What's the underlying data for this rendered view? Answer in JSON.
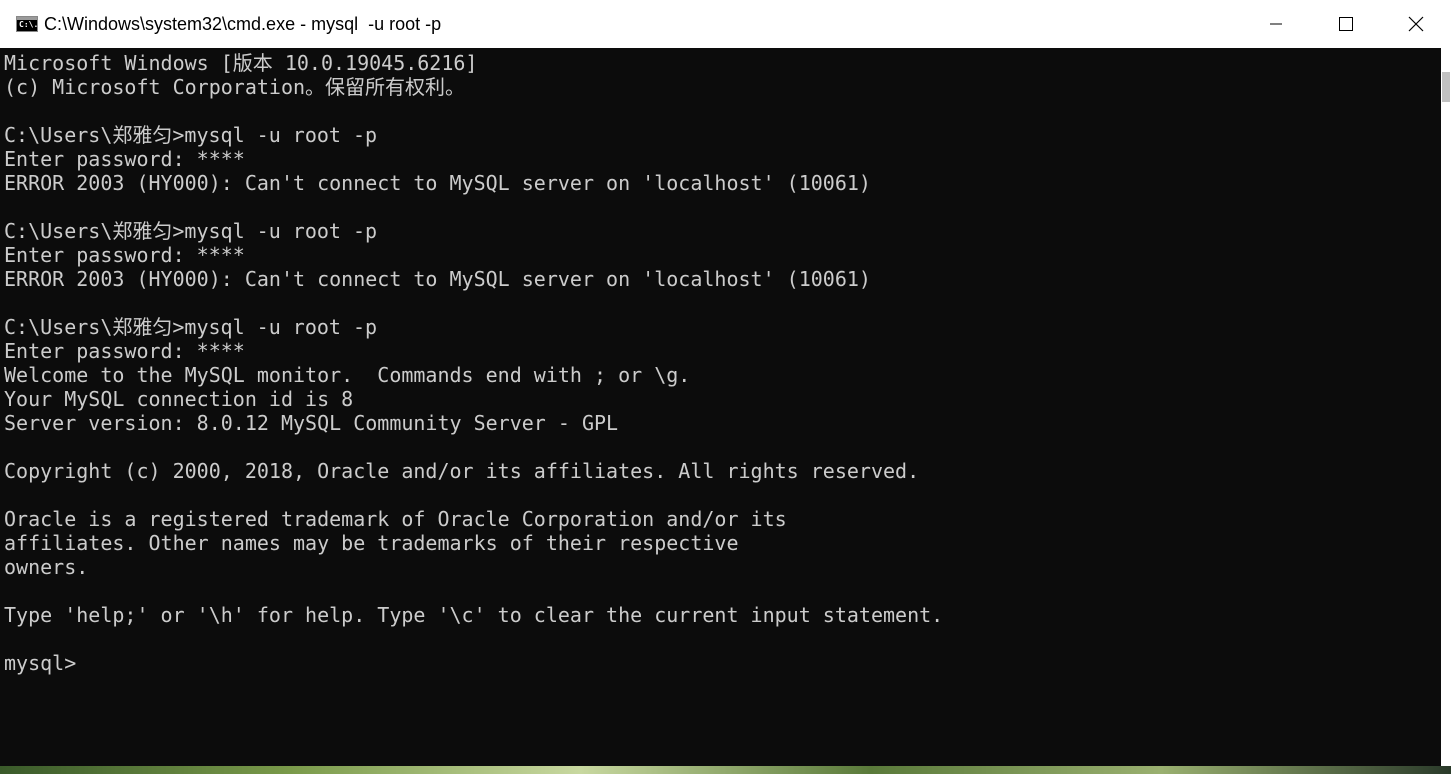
{
  "window": {
    "title": "C:\\Windows\\system32\\cmd.exe - mysql  -u root -p",
    "icon": "cmd-icon",
    "icon_label": "C:\\."
  },
  "controls": {
    "minimize": "minimize-icon",
    "maximize": "maximize-icon",
    "close": "close-icon"
  },
  "console": {
    "lines": [
      "Microsoft Windows [版本 10.0.19045.6216]",
      "(c) Microsoft Corporation。保留所有权利。",
      "",
      "C:\\Users\\郑雅匀>mysql -u root -p",
      "Enter password: ****",
      "ERROR 2003 (HY000): Can't connect to MySQL server on 'localhost' (10061)",
      "",
      "C:\\Users\\郑雅匀>mysql -u root -p",
      "Enter password: ****",
      "ERROR 2003 (HY000): Can't connect to MySQL server on 'localhost' (10061)",
      "",
      "C:\\Users\\郑雅匀>mysql -u root -p",
      "Enter password: ****",
      "Welcome to the MySQL monitor.  Commands end with ; or \\g.",
      "Your MySQL connection id is 8",
      "Server version: 8.0.12 MySQL Community Server - GPL",
      "",
      "Copyright (c) 2000, 2018, Oracle and/or its affiliates. All rights reserved.",
      "",
      "Oracle is a registered trademark of Oracle Corporation and/or its",
      "affiliates. Other names may be trademarks of their respective",
      "owners.",
      "",
      "Type 'help;' or '\\h' for help. Type '\\c' to clear the current input statement.",
      "",
      "mysql>"
    ]
  },
  "colors": {
    "console_bg": "#0c0c0c",
    "console_fg": "#cccccc",
    "titlebar_bg": "#ffffff"
  }
}
